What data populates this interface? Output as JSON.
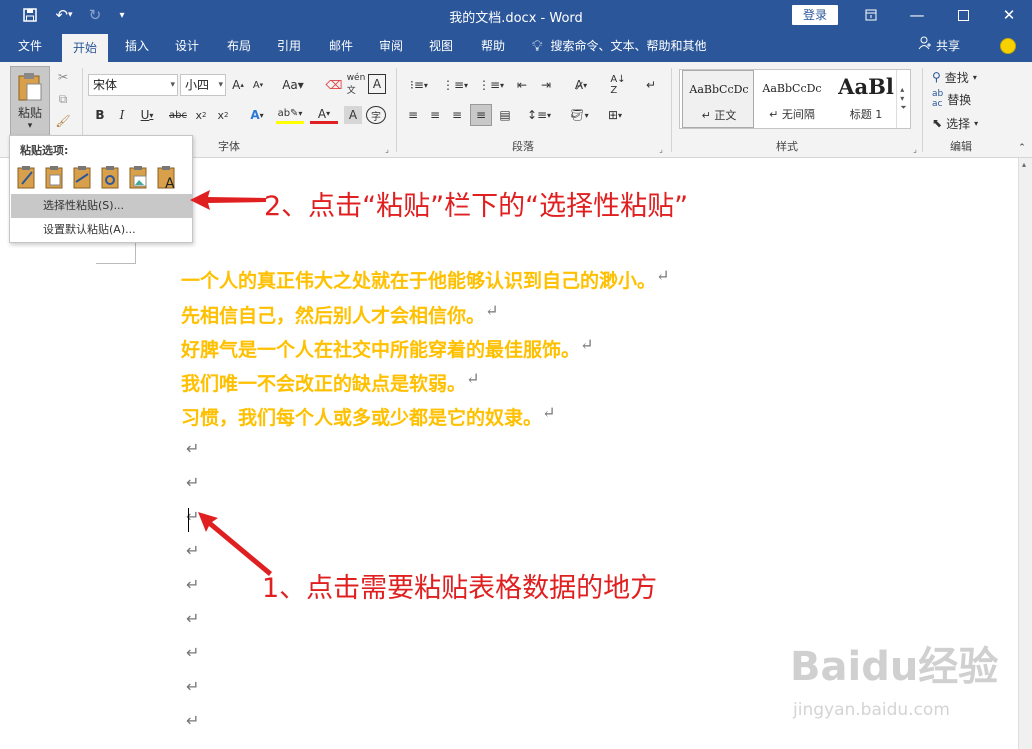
{
  "window": {
    "title": "我的文档.docx - Word",
    "login": "登录"
  },
  "tabs": [
    "文件",
    "开始",
    "插入",
    "设计",
    "布局",
    "引用",
    "邮件",
    "审阅",
    "视图",
    "帮助"
  ],
  "search": {
    "text": "搜索命令、文本、帮助和其他"
  },
  "share": {
    "label": "共享"
  },
  "clipboard": {
    "paste_label": "粘贴"
  },
  "font": {
    "name": "宋体",
    "size": "小四",
    "group_label": "字体"
  },
  "paragraph": {
    "group_label": "段落"
  },
  "styles": {
    "group_label": "样式",
    "items": [
      {
        "preview": "AaBbCcDc",
        "name": "↵ 正文"
      },
      {
        "preview": "AaBbCcDc",
        "name": "↵ 无间隔"
      },
      {
        "preview": "AaBl",
        "name": "标题 1"
      }
    ]
  },
  "editing": {
    "group_label": "编辑",
    "find": "查找",
    "replace": "替换",
    "select": "选择"
  },
  "paste_menu": {
    "header": "粘贴选项:",
    "item1": "选择性粘贴(S)...",
    "item2": "设置默认粘贴(A)..."
  },
  "document": {
    "lines": [
      "一个人的真正伟大之处就在于他能够认识到自己的渺小。",
      "先相信自己，然后别人才会相信你。",
      "好脾气是一个人在社交中所能穿着的最佳服饰。",
      "我们唯一不会改正的缺点是软弱。",
      "习惯，我们每个人或多或少都是它的奴隶。"
    ],
    "paragraph_mark": "↵"
  },
  "annotations": {
    "step2": "2、点击“粘贴”栏下的“选择性粘贴”",
    "step1": "1、点击需要粘贴表格数据的地方",
    "color": "#e02020"
  },
  "watermark": {
    "brand": "Baidu经验",
    "url": "jingyan.baidu.com"
  },
  "colors": {
    "brand": "#2b579a",
    "text_highlight": "#ffc000"
  }
}
